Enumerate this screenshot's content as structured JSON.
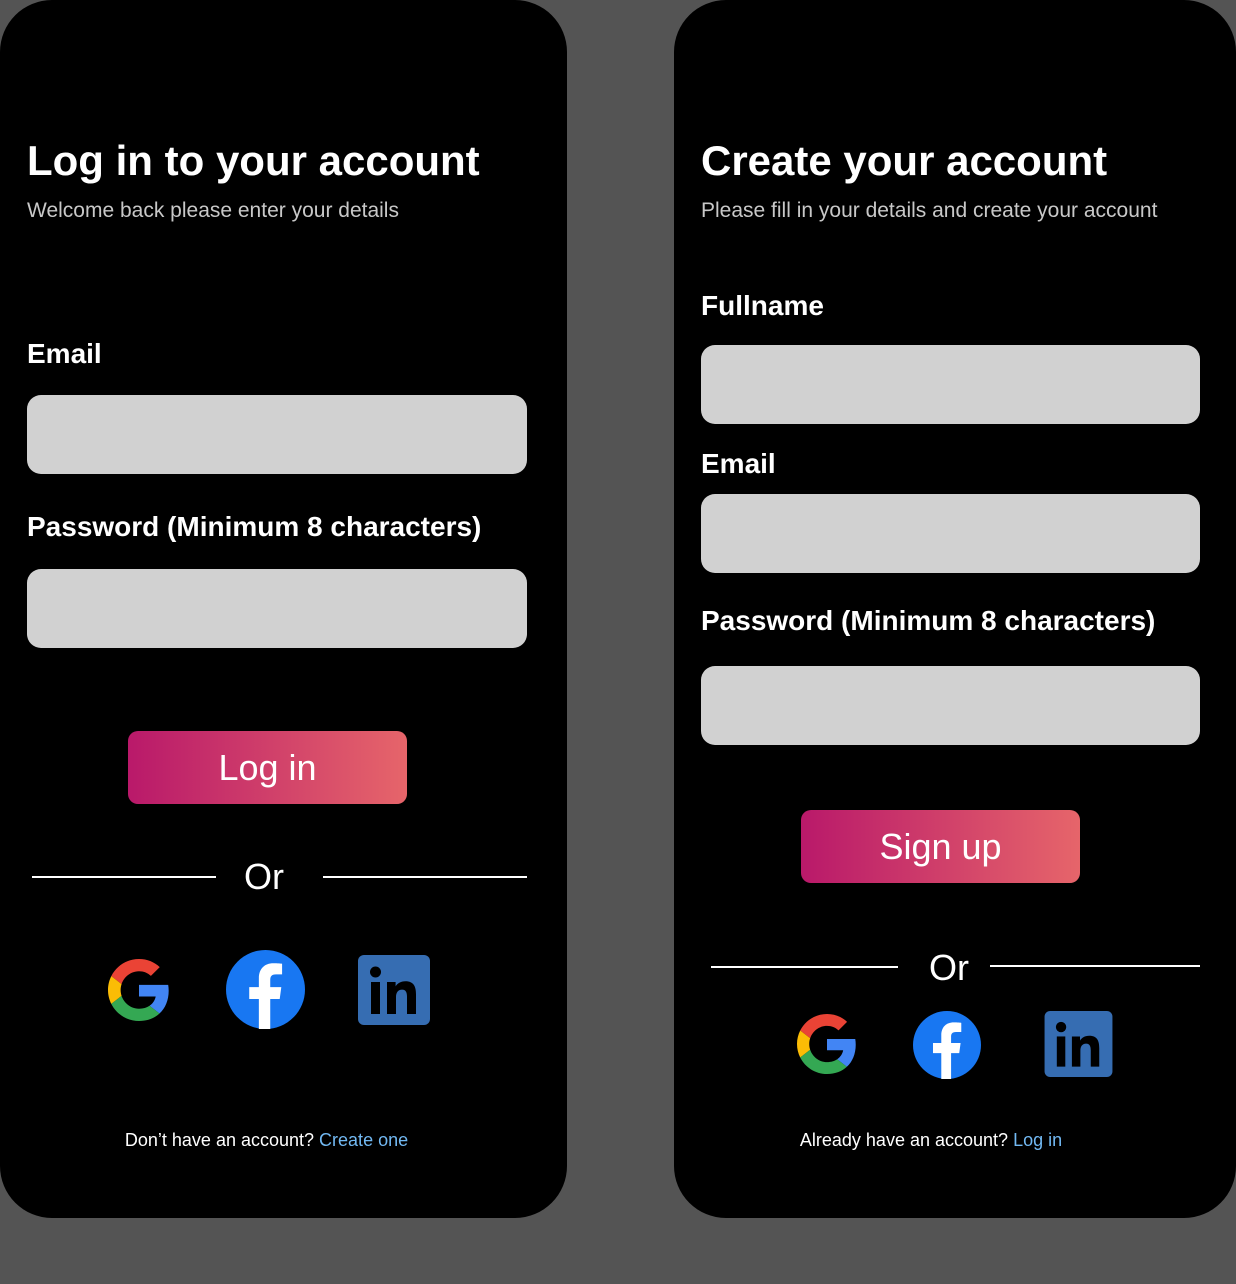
{
  "login": {
    "title": "Log in to your account",
    "subtitle": "Welcome back please enter your details",
    "email_label": "Email",
    "email_value": "",
    "password_label": "Password (Minimum 8 characters)",
    "password_value": "",
    "submit_label": "Log in",
    "or_text": "Or",
    "social": [
      "google-icon",
      "facebook-icon",
      "linkedin-icon"
    ],
    "footer_text": "Don’t have an account?",
    "footer_link": "Create one"
  },
  "signup": {
    "title": "Create your account",
    "subtitle": "Please fill in your details and create your account",
    "fullname_label": "Fullname",
    "fullname_value": "",
    "email_label": "Email",
    "email_value": "",
    "password_label": "Password (Minimum 8 characters)",
    "password_value": "",
    "submit_label": "Sign up",
    "or_text": "Or",
    "social": [
      "google-icon",
      "facebook-icon",
      "linkedin-icon"
    ],
    "footer_text": "Already have an account?",
    "footer_link": "Log in"
  },
  "colors": {
    "background": "#545454",
    "screen": "#000000",
    "field": "#d1d1d1",
    "button_gradient_start": "#b9196a",
    "button_gradient_end": "#e6656a",
    "link": "#72b9f3",
    "facebook": "#1877f2",
    "linkedin": "#366db2"
  }
}
